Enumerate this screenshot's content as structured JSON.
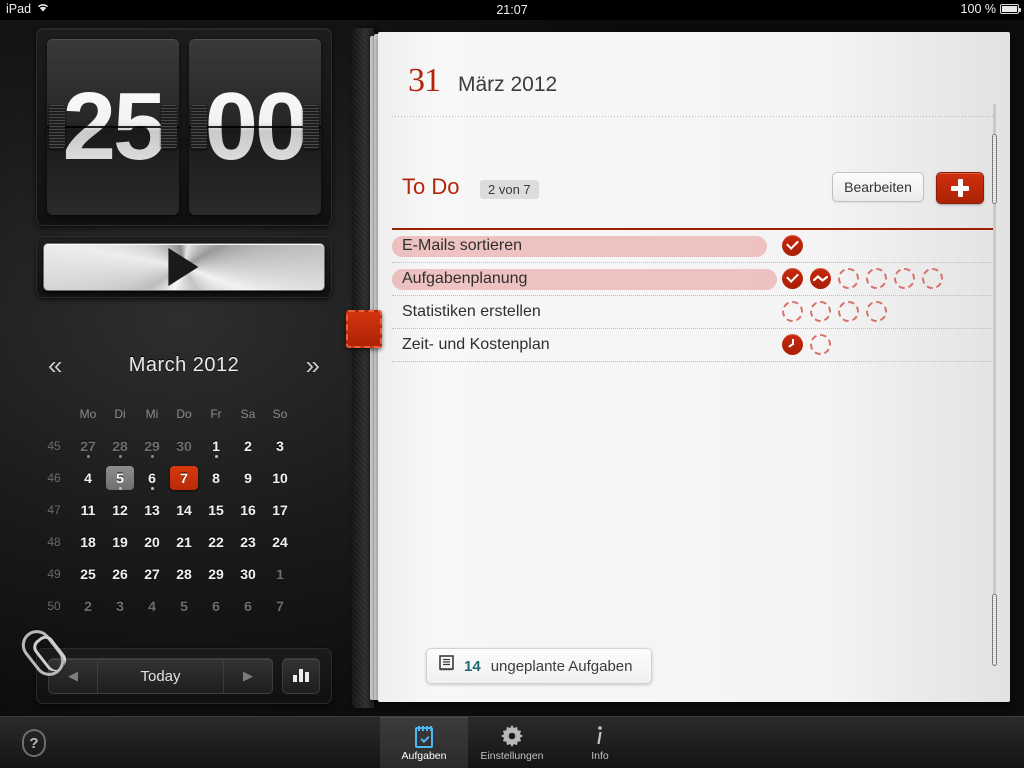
{
  "statusbar": {
    "carrier": "iPad",
    "wifi_icon": "wifi-icon",
    "time": "21:07",
    "battery_pct": "100 %"
  },
  "timer": {
    "minutes": "25",
    "seconds": "00",
    "play_icon": "play-icon"
  },
  "calendar": {
    "title": "March 2012",
    "prev_icon": "chevron-double-left-icon",
    "next_icon": "chevron-double-right-icon",
    "weekdays": [
      "Mo",
      "Di",
      "Mi",
      "Do",
      "Fr",
      "Sa",
      "So"
    ],
    "weeks": [
      {
        "number": "45",
        "days": [
          {
            "n": "27",
            "state": "muted",
            "dot": true
          },
          {
            "n": "28",
            "state": "muted",
            "dot": true
          },
          {
            "n": "29",
            "state": "muted",
            "dot": true
          },
          {
            "n": "30",
            "state": "muted",
            "dot": false
          },
          {
            "n": "1",
            "state": "normal",
            "dot": true
          },
          {
            "n": "2",
            "state": "normal",
            "dot": false
          },
          {
            "n": "3",
            "state": "normal",
            "dot": false
          }
        ]
      },
      {
        "number": "46",
        "days": [
          {
            "n": "4",
            "state": "normal",
            "dot": false
          },
          {
            "n": "5",
            "state": "today",
            "dot": true
          },
          {
            "n": "6",
            "state": "normal",
            "dot": true
          },
          {
            "n": "7",
            "state": "selected",
            "dot": false
          },
          {
            "n": "8",
            "state": "normal",
            "dot": false
          },
          {
            "n": "9",
            "state": "normal",
            "dot": false
          },
          {
            "n": "10",
            "state": "normal",
            "dot": false
          }
        ]
      },
      {
        "number": "47",
        "days": [
          {
            "n": "11",
            "state": "normal",
            "dot": false
          },
          {
            "n": "12",
            "state": "normal",
            "dot": false
          },
          {
            "n": "13",
            "state": "normal",
            "dot": false
          },
          {
            "n": "14",
            "state": "normal",
            "dot": false
          },
          {
            "n": "15",
            "state": "normal",
            "dot": false
          },
          {
            "n": "16",
            "state": "normal",
            "dot": false
          },
          {
            "n": "17",
            "state": "normal",
            "dot": false
          }
        ]
      },
      {
        "number": "48",
        "days": [
          {
            "n": "18",
            "state": "normal",
            "dot": false
          },
          {
            "n": "19",
            "state": "normal",
            "dot": false
          },
          {
            "n": "20",
            "state": "normal",
            "dot": false
          },
          {
            "n": "21",
            "state": "normal",
            "dot": false
          },
          {
            "n": "22",
            "state": "normal",
            "dot": false
          },
          {
            "n": "23",
            "state": "normal",
            "dot": false
          },
          {
            "n": "24",
            "state": "normal",
            "dot": false
          }
        ]
      },
      {
        "number": "49",
        "days": [
          {
            "n": "25",
            "state": "normal",
            "dot": false
          },
          {
            "n": "26",
            "state": "normal",
            "dot": false
          },
          {
            "n": "27",
            "state": "normal",
            "dot": false
          },
          {
            "n": "28",
            "state": "normal",
            "dot": false
          },
          {
            "n": "29",
            "state": "normal",
            "dot": false
          },
          {
            "n": "30",
            "state": "normal",
            "dot": false
          },
          {
            "n": "1",
            "state": "muted",
            "dot": false
          }
        ]
      },
      {
        "number": "50",
        "days": [
          {
            "n": "2",
            "state": "muted",
            "dot": false
          },
          {
            "n": "3",
            "state": "muted",
            "dot": false
          },
          {
            "n": "4",
            "state": "muted",
            "dot": false
          },
          {
            "n": "5",
            "state": "muted",
            "dot": false
          },
          {
            "n": "6",
            "state": "muted",
            "dot": false
          },
          {
            "n": "6",
            "state": "muted",
            "dot": false
          },
          {
            "n": "7",
            "state": "muted",
            "dot": false
          }
        ]
      }
    ],
    "toolbar": {
      "prev_icon": "triangle-left-icon",
      "today_label": "Today",
      "next_icon": "triangle-right-icon",
      "stats_icon": "bar-chart-icon"
    }
  },
  "page": {
    "date_day": "31",
    "date_rest": "März 2012",
    "section_title": "To Do",
    "section_count": "2 von 7",
    "edit_label": "Bearbeiten",
    "add_icon": "plus-icon",
    "tasks": [
      {
        "label": "E-Mails sortieren",
        "completed": true,
        "mark_width": 375,
        "pomodoros": [
          "done"
        ]
      },
      {
        "label": "Aufgabenplanung",
        "completed": true,
        "mark_width": 385,
        "pomodoros": [
          "done",
          "active",
          "empty",
          "empty",
          "empty",
          "empty"
        ]
      },
      {
        "label": "Statistiken erstellen",
        "completed": false,
        "mark_width": 0,
        "pomodoros": [
          "empty",
          "empty",
          "empty",
          "empty"
        ]
      },
      {
        "label": "Zeit- und Kostenplan",
        "completed": false,
        "mark_width": 0,
        "pomodoros": [
          "clock",
          "empty"
        ]
      }
    ],
    "unplanned": {
      "icon": "list-icon",
      "count": "14",
      "label": "ungeplante Aufgaben"
    },
    "clip_icon": "paperclip-icon",
    "bookmark_icon": "bookmark-tab-icon"
  },
  "tabbar": {
    "help_icon": "help-icon",
    "tabs": [
      {
        "label": "Aufgaben",
        "icon": "notepad-check-icon",
        "active": true
      },
      {
        "label": "Einstellungen",
        "icon": "gear-icon",
        "active": false
      },
      {
        "label": "Info",
        "icon": "info-icon",
        "active": false
      }
    ]
  },
  "colors": {
    "accent_red": "#b3260c",
    "teal": "#1a6b72",
    "tab_blue": "#4db8ef"
  }
}
